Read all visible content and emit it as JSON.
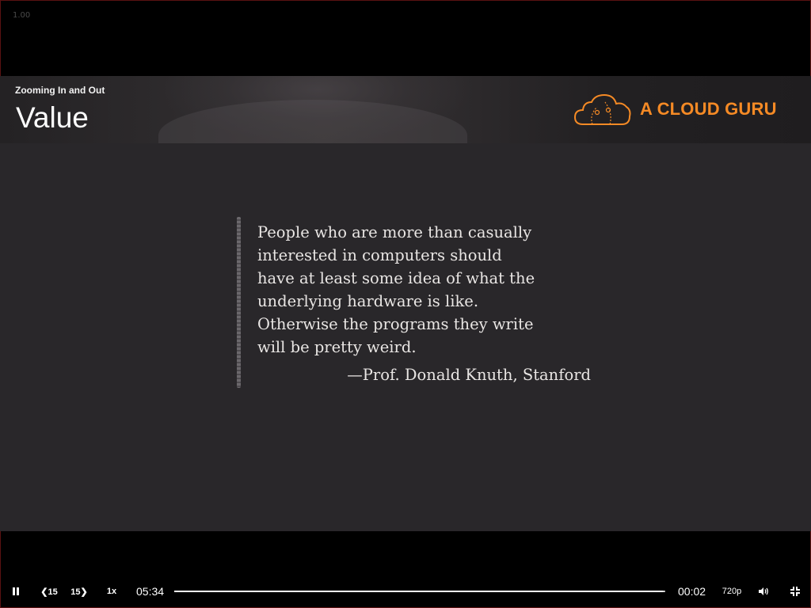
{
  "zoom_readout": "1.00",
  "header": {
    "course_section": "Zooming In and Out",
    "slide_title": "Value",
    "brand_name": "A CLOUD GURU",
    "brand_color": "#f58a25"
  },
  "slide": {
    "quote_lines": [
      "People who are more than casually",
      "interested in computers should",
      "have at least some idea of what the",
      "underlying hardware is like.",
      "Otherwise the programs they write",
      "will be pretty weird."
    ],
    "attribution": "—Prof. Donald Knuth, Stanford"
  },
  "player": {
    "skip_back_label": "❮15",
    "skip_forward_label": "15❯",
    "speed_label": "1x",
    "elapsed_time": "05:34",
    "remaining_time": "00:02",
    "progress": 0.995,
    "quality_label": "720p",
    "icons": {
      "play_pause": "pause-icon",
      "volume": "volume-icon",
      "fullscreen": "exit-fullscreen-icon"
    }
  }
}
